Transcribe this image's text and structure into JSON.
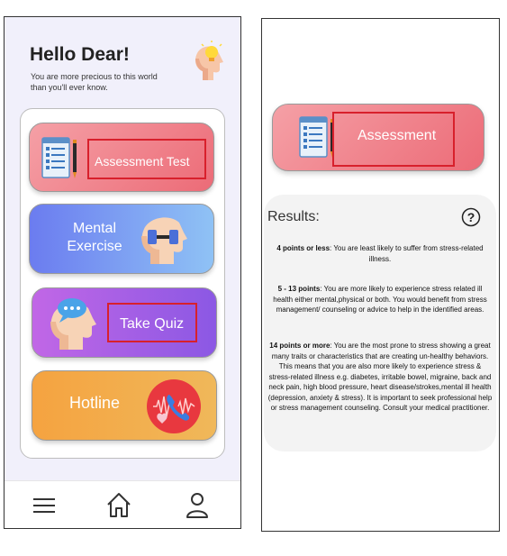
{
  "left_screen": {
    "greeting": {
      "title": "Hello Dear!",
      "subtitle": "You are more precious to this world than you'll ever know."
    },
    "menu": [
      {
        "label": "Assessment Test",
        "icon": "checklist-pen-icon",
        "color_from": "#f5a0a6",
        "color_to": "#ec6b77"
      },
      {
        "label": "Mental Exercise",
        "icon": "head-dumbbell-icon",
        "color_from": "#6b7cf0",
        "color_to": "#8fc2f5"
      },
      {
        "label": "Take Quiz",
        "icon": "head-chat-icon",
        "color_from": "#c167e6",
        "color_to": "#8b58e4"
      },
      {
        "label": "Hotline",
        "icon": "phone-heart-icon",
        "color_from": "#f5a340",
        "color_to": "#f0b85a"
      }
    ],
    "bottom_nav": [
      {
        "icon": "menu-icon"
      },
      {
        "icon": "home-icon"
      },
      {
        "icon": "user-icon"
      }
    ]
  },
  "right_screen": {
    "card": {
      "label": "Assessment",
      "icon": "checklist-pen-icon"
    },
    "results": {
      "title": "Results:",
      "help_icon": "question-icon",
      "blocks": [
        {
          "heading": "4 points or less",
          "text": ": You are least likely to suffer from stress-related illness."
        },
        {
          "heading": "5 - 13 points",
          "text": ": You are more likely to experience stress related ill health either mental,physical or both. You would benefit from stress management/ counseling or advice to help in the identified areas."
        },
        {
          "heading": "14 points or more",
          "text": ": You are the most prone to stress showing a great many traits or characteristics that are creating un-healthy behaviors. This means that you are also more likely to experience stress & stress-related illness e.g. diabetes, irritable bowel, migraine, back and neck pain, high blood pressure, heart disease/strokes,mental ill health (depression, anxiety & stress). It is important to seek professional help or stress management counseling. Consult your medical practitioner."
        }
      ]
    }
  },
  "colors": {
    "highlight": "#d8202c",
    "left_background": "#f1f0fb",
    "results_background": "#f3f3f3"
  }
}
